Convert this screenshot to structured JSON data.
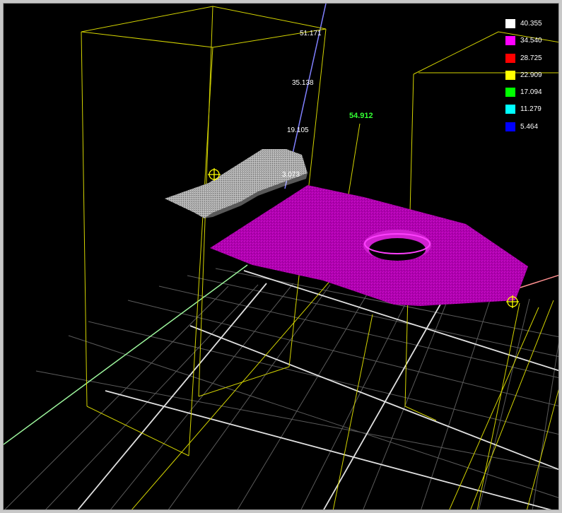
{
  "scale_labels": [
    "51.171",
    "35.138",
    "19.105",
    "3.073"
  ],
  "measurement": {
    "value": "54.912"
  },
  "legend": [
    {
      "value": "40.355",
      "color": "#ffffff"
    },
    {
      "value": "34.540",
      "color": "#ff00ff"
    },
    {
      "value": "28.725",
      "color": "#ff0000"
    },
    {
      "value": "22.909",
      "color": "#ffff00"
    },
    {
      "value": "17.094",
      "color": "#00ff00"
    },
    {
      "value": "11.279",
      "color": "#00ffff"
    },
    {
      "value": "5.464",
      "color": "#0000ff"
    }
  ],
  "colors": {
    "background": "#000000",
    "grid": "#ffffff",
    "bounding_box": "#ffff00",
    "surface": "#b800b8",
    "scan_strip": "#a8a8a8",
    "measurement_text": "#33ff33"
  }
}
